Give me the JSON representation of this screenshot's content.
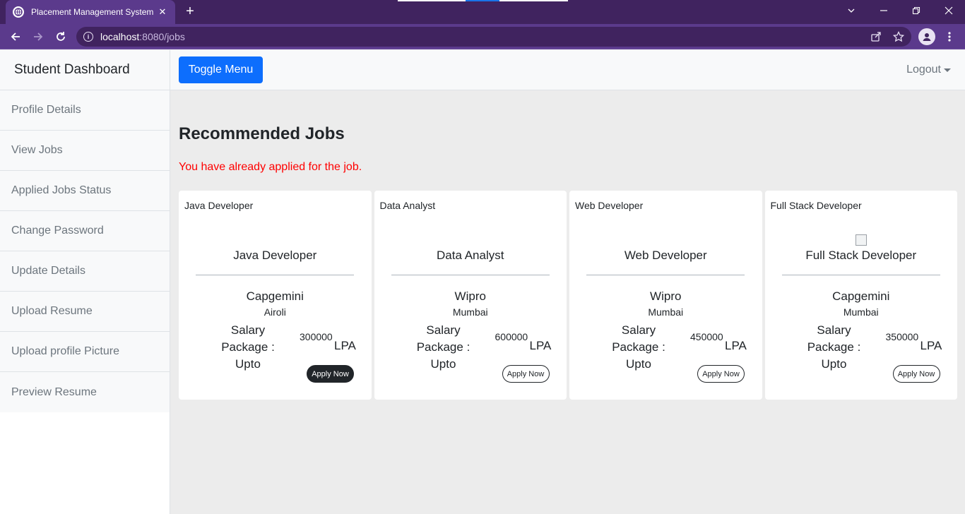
{
  "browser": {
    "tab_title": "Placement Management System",
    "tab_close": "✕",
    "new_tab": "+",
    "url_host": "localhost",
    "url_path": ":8080/jobs"
  },
  "sidebar": {
    "heading": "Student Dashboard",
    "items": [
      {
        "label": "Profile Details"
      },
      {
        "label": "View Jobs"
      },
      {
        "label": "Applied Jobs Status"
      },
      {
        "label": "Change Password"
      },
      {
        "label": "Update Details"
      },
      {
        "label": "Upload Resume"
      },
      {
        "label": "Upload profile Picture"
      },
      {
        "label": "Preview Resume"
      }
    ]
  },
  "topnav": {
    "toggle_label": "Toggle Menu",
    "logout_label": "Logout"
  },
  "main": {
    "title": "Recommended Jobs",
    "message": "You have already applied for the job.",
    "jobs": [
      {
        "header": "Java Developer",
        "title": "Java Developer",
        "company": "Capgemini",
        "location": "Airoli",
        "salary_label": "Salary Package : Upto",
        "salary": "300000",
        "unit": "LPA",
        "apply_label": "Apply Now",
        "apply_style": "dark"
      },
      {
        "header": "Data Analyst",
        "title": "Data Analyst",
        "company": "Wipro",
        "location": "Mumbai",
        "salary_label": "Salary Package : Upto",
        "salary": "600000",
        "unit": "LPA",
        "apply_label": "Apply Now",
        "apply_style": "outline"
      },
      {
        "header": "Web Developer",
        "title": "Web Developer",
        "company": "Wipro",
        "location": "Mumbai",
        "salary_label": "Salary Package : Upto",
        "salary": "450000",
        "unit": "LPA",
        "apply_label": "Apply Now",
        "apply_style": "outline"
      },
      {
        "header": "Full Stack Developer",
        "title": "Full Stack Developer",
        "company": "Capgemini",
        "location": "Mumbai",
        "salary_label": "Salary Package : Upto",
        "salary": "350000",
        "unit": "LPA",
        "apply_label": "Apply Now",
        "apply_style": "outline"
      }
    ]
  },
  "colors": {
    "browser_frame": "#40235f",
    "browser_toolbar": "#5b3a8c",
    "primary_button": "#0d6efd",
    "alert_text": "#ff0000"
  }
}
